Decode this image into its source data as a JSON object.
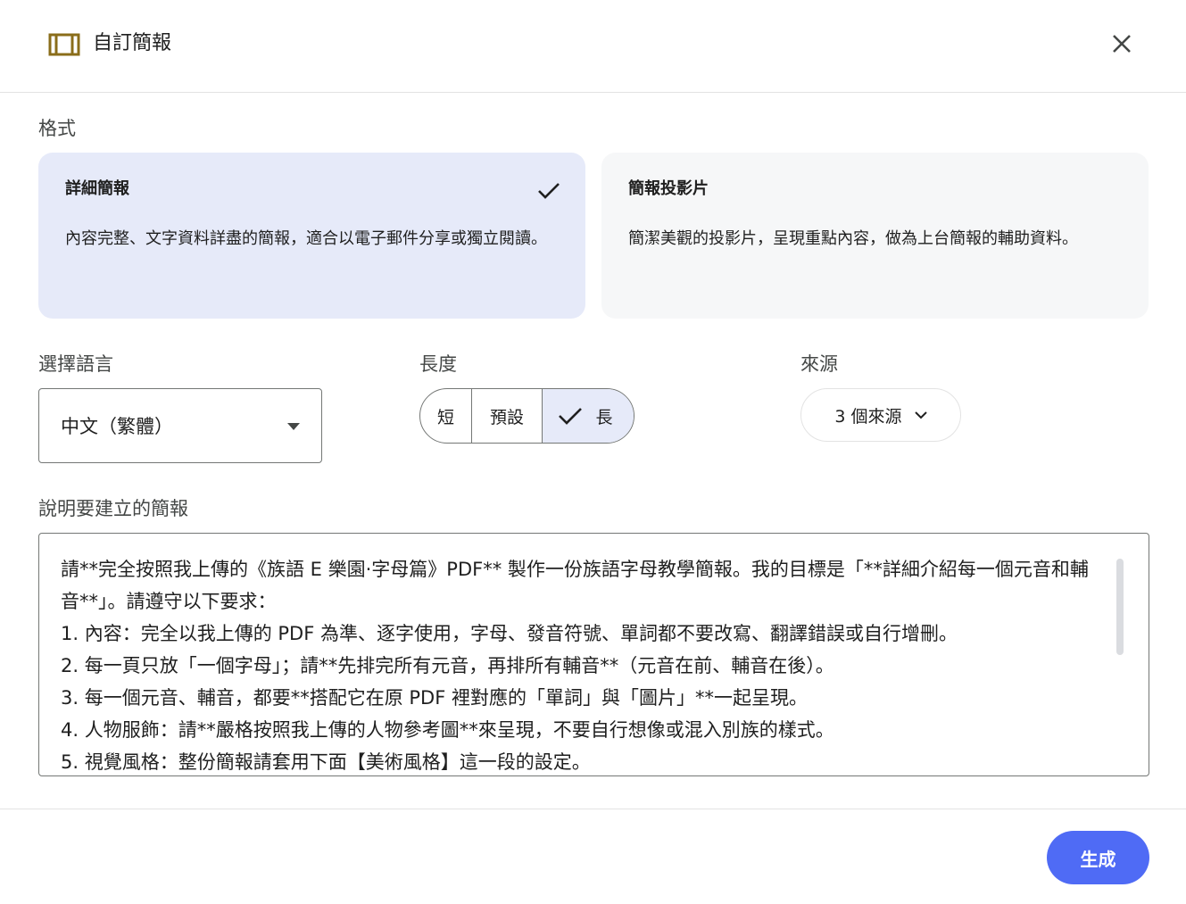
{
  "header": {
    "title": "自訂簡報",
    "icon": "slides-icon",
    "close_icon": "close-icon"
  },
  "format": {
    "label": "格式",
    "options": [
      {
        "title": "詳細簡報",
        "description": "內容完整、文字資料詳盡的簡報，適合以電子郵件分享或獨立閱讀。",
        "selected": true
      },
      {
        "title": "簡報投影片",
        "description": "簡潔美觀的投影片，呈現重點內容，做為上台簡報的輔助資料。",
        "selected": false
      }
    ]
  },
  "language": {
    "label": "選擇語言",
    "value": "中文（繁體）"
  },
  "length": {
    "label": "長度",
    "options": [
      "短",
      "預設",
      "長"
    ],
    "selected": "長"
  },
  "sources": {
    "label": "來源",
    "button": "3 個來源"
  },
  "description": {
    "label": "說明要建立的簡報",
    "text": "請**完全按照我上傳的《族語 E 樂園·字母篇》PDF** 製作一份族語字母教學簡報。我的目標是「**詳細介紹每一個元音和輔音**」。請遵守以下要求：\n1. 內容：完全以我上傳的 PDF 為準、逐字使用，字母、發音符號、單詞都不要改寫、翻譯錯誤或自行增刪。\n2. 每一頁只放「一個字母」；請**先排完所有元音，再排所有輔音**（元音在前、輔音在後）。\n3. 每一個元音、輔音，都要**搭配它在原 PDF 裡對應的「單詞」與「圖片」**一起呈現。\n4. 人物服飾：請**嚴格按照我上傳的人物參考圖**來呈現，不要自行想像或混入別族的樣式。\n5. 視覺風格：整份簡報請套用下面【美術風格】這一段的設定。"
  },
  "footer": {
    "generate_label": "生成"
  },
  "colors": {
    "accent": "#4f6bf5",
    "selected_bg": "#e6eaf9",
    "card_bg": "#f6f7f8",
    "icon_gold": "#8a6d1a"
  }
}
